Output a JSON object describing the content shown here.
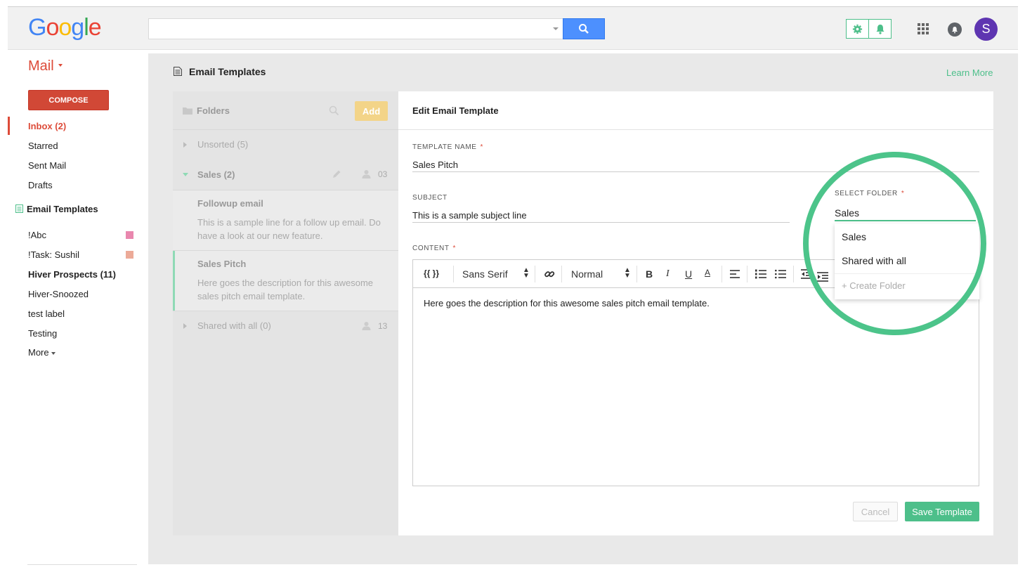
{
  "header": {
    "logo_letters": [
      {
        "ch": "G",
        "color": "#4285f4"
      },
      {
        "ch": "o",
        "color": "#ea4335"
      },
      {
        "ch": "o",
        "color": "#fbbc05"
      },
      {
        "ch": "g",
        "color": "#4285f4"
      },
      {
        "ch": "l",
        "color": "#34a853"
      },
      {
        "ch": "e",
        "color": "#ea4335"
      }
    ],
    "search_value": "",
    "avatar_letter": "S"
  },
  "nav": {
    "mail_label": "Mail",
    "compose_label": "COMPOSE",
    "items": [
      {
        "label": "Inbox (2)"
      },
      {
        "label": "Starred"
      },
      {
        "label": "Sent Mail"
      },
      {
        "label": "Drafts"
      },
      {
        "label": "Email Templates"
      }
    ],
    "labels": [
      {
        "label": "!Abc",
        "color": "#e987ae"
      },
      {
        "label": "!Task: Sushil",
        "color": "#ecaa98"
      },
      {
        "label": "Hiver Prospects (11)"
      },
      {
        "label": "Hiver-Snoozed"
      },
      {
        "label": "test label"
      },
      {
        "label": "Testing"
      },
      {
        "label": "More"
      }
    ]
  },
  "main": {
    "title": "Email Templates",
    "learn_more": "Learn More"
  },
  "folders": {
    "header": "Folders",
    "add_label": "Add",
    "unsorted": "Unsorted (5)",
    "sales": "Sales (2)",
    "sales_count": "03",
    "templates": [
      {
        "title": "Followup email",
        "body": "This is a sample line for a follow up email. Do have a look at our new feature."
      },
      {
        "title": "Sales Pitch",
        "body": "Here goes the description for this awesome sales pitch email template."
      }
    ],
    "shared": "Shared with all (0)",
    "shared_count": "13"
  },
  "editor": {
    "title": "Edit Email Template",
    "template_name_label": "TEMPLATE NAME",
    "template_name_value": "Sales Pitch",
    "subject_label": "SUBJECT",
    "subject_value": "This is a sample subject line",
    "content_label": "CONTENT",
    "required_mark": "*",
    "toolbar": {
      "variables": "{{ }}",
      "font": "Sans Serif",
      "size": "Normal",
      "bold": "B",
      "italic": "I",
      "underline": "U",
      "color": "A"
    },
    "content_text": "Here goes the description for this awesome sales pitch email template.",
    "cancel_label": "Cancel",
    "save_label": "Save Template"
  },
  "folder_select": {
    "label": "SELECT FOLDER",
    "value": "Sales",
    "options": [
      "Sales",
      "Shared with all"
    ],
    "create_label": "+ Create Folder"
  },
  "colors": {
    "accent": "#4dbf8a",
    "gmail_red": "#dd4b39",
    "compose": "#d14836",
    "highlight_ring": "#4cc48a"
  }
}
